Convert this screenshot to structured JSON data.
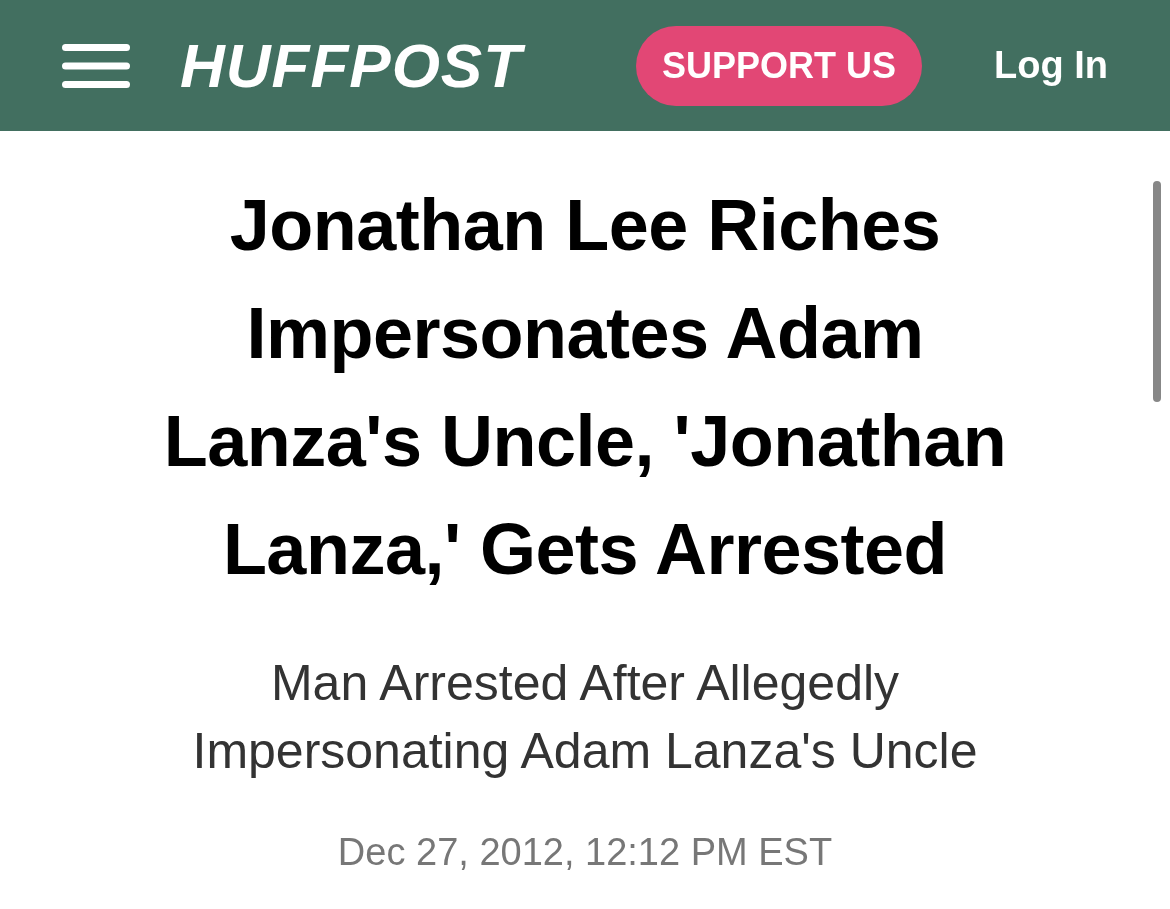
{
  "header": {
    "logo": "HUFFPOST",
    "support_button": "SUPPORT US",
    "login_link": "Log In"
  },
  "article": {
    "headline": "Jonathan Lee Riches Impersonates Adam Lanza's Uncle, 'Jonathan Lanza,' Gets Arrested",
    "subheadline": "Man Arrested After Allegedly Impersonating Adam Lanza's Uncle",
    "date": "Dec 27, 2012, 12:12 PM EST"
  }
}
